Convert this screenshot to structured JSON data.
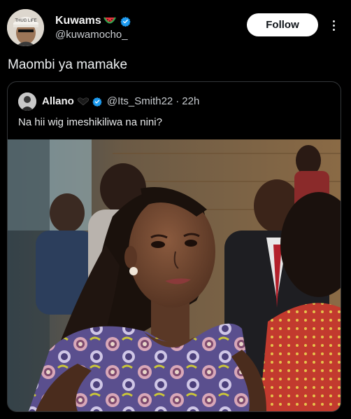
{
  "tweet": {
    "display_name": "Kuwams",
    "handle": "@kuwamocho_",
    "name_emoji": "watermelon-icon",
    "verified_icon": "verified-badge-icon",
    "follow_label": "Follow",
    "text": "Maombi ya mamake",
    "avatar_cap_text": "THUG LIFE",
    "colors": {
      "accent": "#1d9bf0",
      "background": "#000000",
      "button_bg": "#ffffff"
    }
  },
  "quote": {
    "display_name": "Allano",
    "name_emoji": "black-heart-icon",
    "verified_icon": "verified-badge-icon",
    "handle": "@Its_Smith22",
    "separator": "·",
    "time": "22h",
    "text": "Na hii wig imeshikiliwa na nini?",
    "photo": "photo-woman-looking-up-in-lecture-hall"
  }
}
